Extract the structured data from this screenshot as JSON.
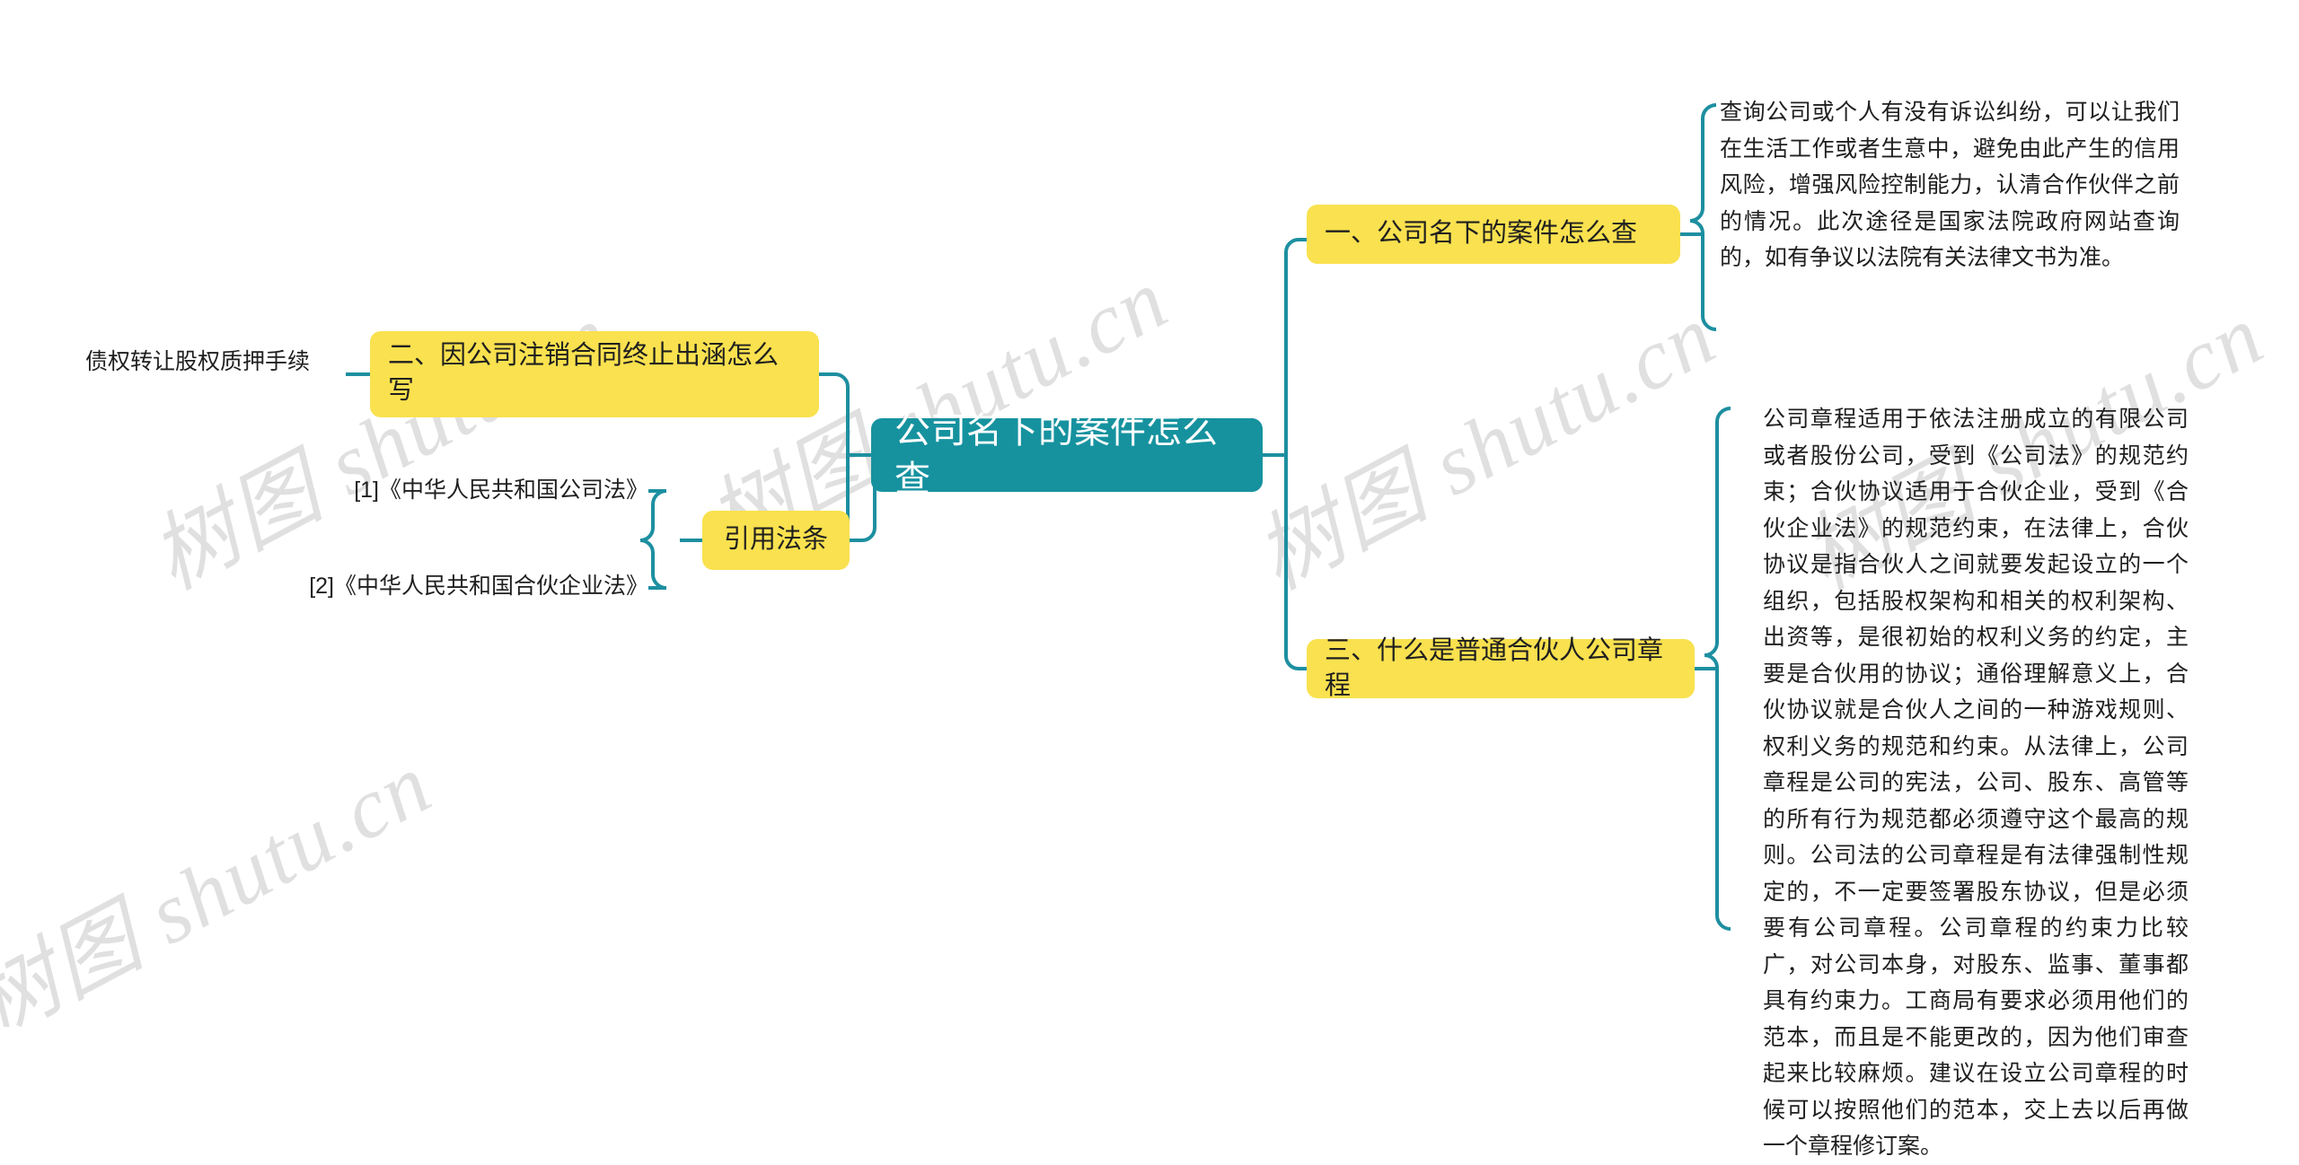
{
  "mindmap": {
    "root": {
      "label": "公司名下的案件怎么查",
      "color": "#16929f"
    },
    "branch_color": "#f9e14f",
    "link_color": "#1d8fa0",
    "branches": [
      {
        "id": "branch-1",
        "label": "一、公司名下的案件怎么查",
        "detail": "查询公司或个人有没有诉讼纠纷，可以让我们在生活工作或者生意中，避免由此产生的信用风险，增强风险控制能力，认清合作伙伴之前的情况。此次途径是国家法院政府网站查询的，如有争议以法院有关法律文书为准。"
      },
      {
        "id": "branch-2",
        "label": "二、因公司注销合同终止出涵怎么写",
        "child_label": "债权转让股权质押手续"
      },
      {
        "id": "branch-3",
        "label": "三、什么是普通合伙人公司章程",
        "detail": "公司章程适用于依法注册成立的有限公司或者股份公司，受到《公司法》的规范约束；合伙协议适用于合伙企业，受到《合伙企业法》的规范约束，在法律上，合伙协议是指合伙人之间就要发起设立的一个组织，包括股权架构和相关的权利架构、出资等，是很初始的权利义务的约定，主要是合伙用的协议；通俗理解意义上，合伙协议就是合伙人之间的一种游戏规则、权利义务的规范和约束。从法律上，公司章程是公司的宪法，公司、股东、高管等的所有行为规范都必须遵守这个最高的规则。公司法的公司章程是有法律强制性规定的，不一定要签署股东协议，但是必须要有公司章程。公司章程的约束力比较广，对公司本身，对股东、监事、董事都具有约束力。工商局有要求必须用他们的范本，而且是不能更改的，因为他们审查起来比较麻烦。建议在设立公司章程的时候可以按照他们的范本，交上去以后再做一个章程修订案。"
      },
      {
        "id": "references",
        "label": "引用法条",
        "items": [
          "[1]《中华人民共和国公司法》",
          "[2]《中华人民共和国合伙企业法》"
        ]
      }
    ]
  },
  "watermark": {
    "text": "树图 shutu.cn"
  }
}
